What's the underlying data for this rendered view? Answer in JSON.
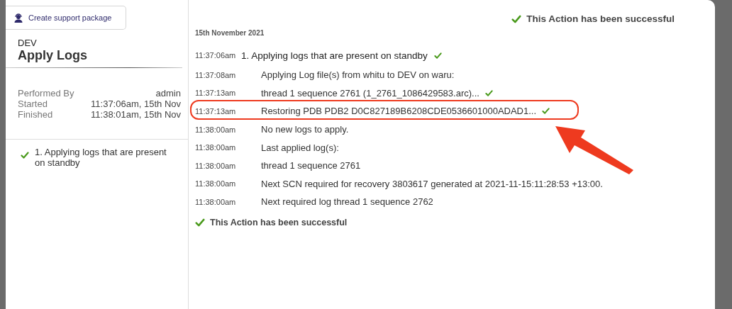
{
  "sidebar": {
    "support_button": "Create support package",
    "environment": "DEV",
    "title": "Apply Logs",
    "details": [
      {
        "label": "Performed By",
        "value": "admin"
      },
      {
        "label": "Started",
        "value": "11:37:06am, 15th Nov"
      },
      {
        "label": "Finished",
        "value": "11:38:01am, 15th Nov"
      }
    ],
    "steps": [
      {
        "label": "1. Applying logs that are present on standby",
        "checked": true
      }
    ]
  },
  "log": {
    "status_top": "This Action has been successful",
    "date": "15th November 2021",
    "entries": [
      {
        "time": "11:37:06am",
        "kind": "step",
        "text": "1. Applying logs that are present on standby",
        "checked": true,
        "highlighted": false
      },
      {
        "time": "11:37:08am",
        "kind": "line",
        "text": "Applying Log file(s) from whitu to DEV on waru:",
        "checked": false,
        "highlighted": false
      },
      {
        "time": "11:37:13am",
        "kind": "line",
        "text": "thread 1 sequence 2761 (1_2761_1086429583.arc)...",
        "checked": true,
        "highlighted": false
      },
      {
        "time": "11:37:13am",
        "kind": "line",
        "text": "Restoring PDB PDB2 D0C827189B6208CDE0536601000ADAD1...",
        "checked": true,
        "highlighted": true
      },
      {
        "time": "11:38:00am",
        "kind": "line",
        "text": "No new logs to apply.",
        "checked": false,
        "highlighted": false
      },
      {
        "time": "11:38:00am",
        "kind": "line",
        "text": "Last applied log(s):",
        "checked": false,
        "highlighted": false
      },
      {
        "time": "11:38:00am",
        "kind": "line",
        "text": "thread 1 sequence 2761",
        "checked": false,
        "highlighted": false
      },
      {
        "time": "11:38:00am",
        "kind": "line",
        "text": "Next SCN required for recovery 3803617 generated at 2021-11-15:11:28:53 +13:00.",
        "checked": false,
        "highlighted": false
      },
      {
        "time": "11:38:00am",
        "kind": "line",
        "text": "Next required log thread 1 sequence 2762",
        "checked": false,
        "highlighted": false
      }
    ],
    "status_bottom": "This Action has been successful"
  }
}
